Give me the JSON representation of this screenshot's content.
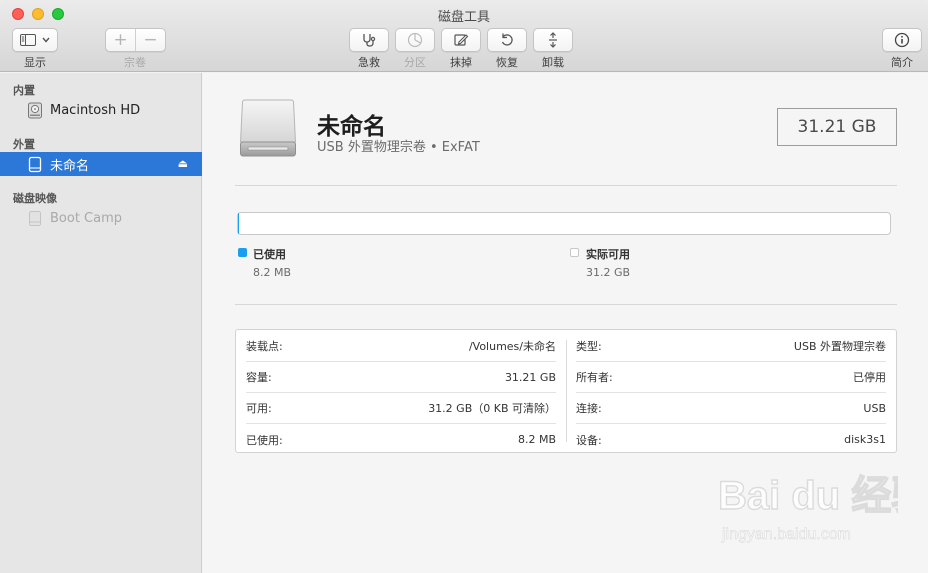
{
  "window": {
    "title": "磁盘工具"
  },
  "toolbar": {
    "view_label": "显示",
    "volume_label": "宗卷",
    "first_aid_label": "急救",
    "partition_label": "分区",
    "erase_label": "抹掉",
    "restore_label": "恢复",
    "unmount_label": "卸载",
    "info_label": "简介"
  },
  "sidebar": {
    "sections": {
      "internal": "内置",
      "external": "外置",
      "disk_images": "磁盘映像"
    },
    "items": [
      {
        "label": "Macintosh HD"
      },
      {
        "label": "未命名"
      },
      {
        "label": "Boot Camp"
      }
    ]
  },
  "volume": {
    "name": "未命名",
    "subtitle": "USB 外置物理宗卷 • ExFAT",
    "capacity": "31.21 GB"
  },
  "usage": {
    "used_label": "已使用",
    "used_value": "8.2 MB",
    "used_color": "#1a9ff0",
    "available_label": "实际可用",
    "available_value": "31.2 GB",
    "available_color": "#ffffff",
    "used_fraction": 0.0003
  },
  "info": {
    "left": [
      {
        "key": "装载点:",
        "value": "/Volumes/未命名"
      },
      {
        "key": "容量:",
        "value": "31.21 GB"
      },
      {
        "key": "可用:",
        "value": "31.2 GB（0 KB 可清除）"
      },
      {
        "key": "已使用:",
        "value": "8.2 MB"
      }
    ],
    "right": [
      {
        "key": "类型:",
        "value": "USB 外置物理宗卷"
      },
      {
        "key": "所有者:",
        "value": "已停用"
      },
      {
        "key": "连接:",
        "value": "USB"
      },
      {
        "key": "设备:",
        "value": "disk3s1"
      }
    ]
  },
  "watermark": {
    "brand": "Bai du 经验",
    "url": "jingyan.baidu.com"
  }
}
